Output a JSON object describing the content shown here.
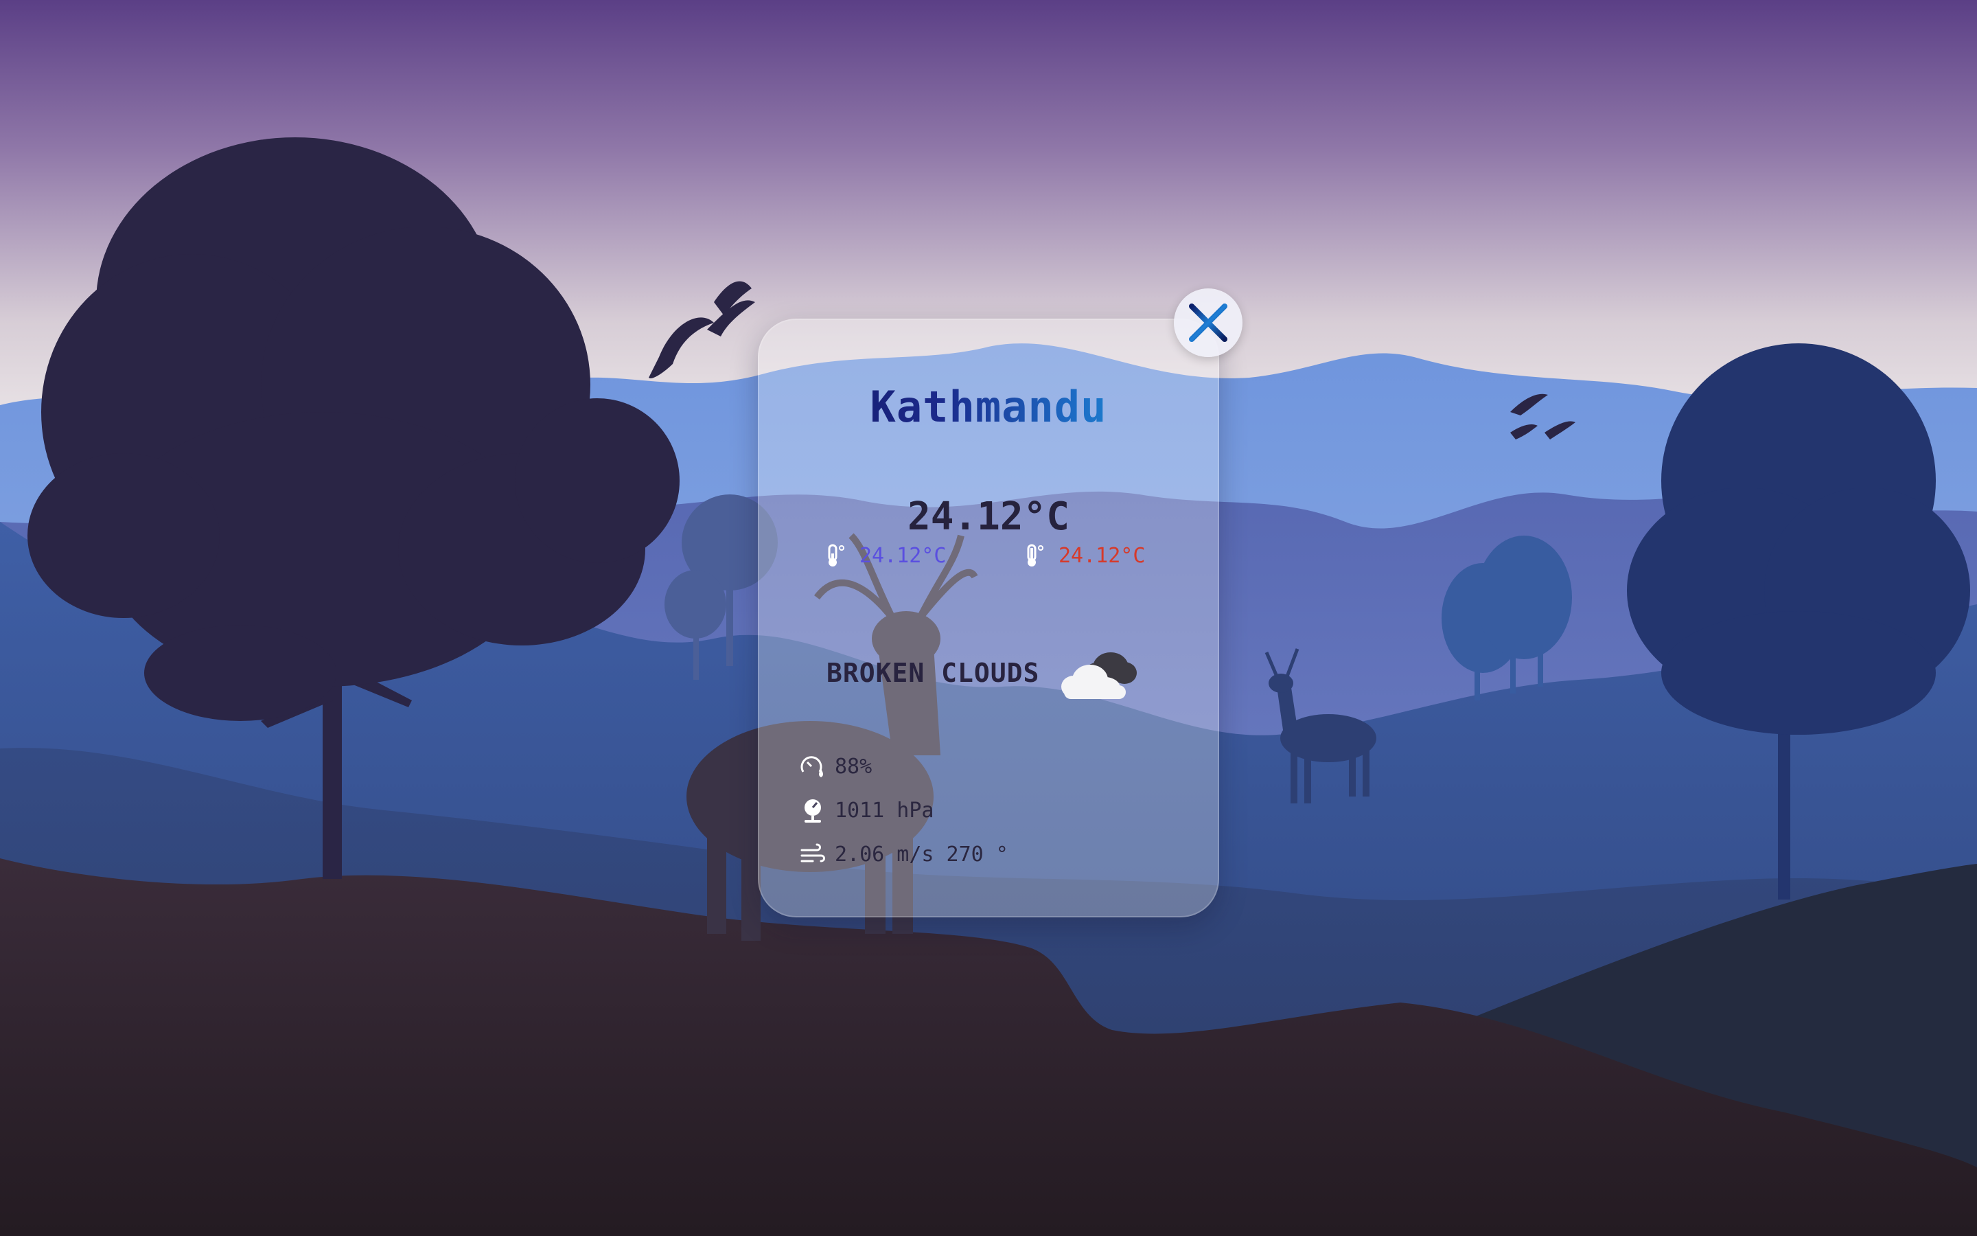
{
  "weather": {
    "city": "Kathmandu",
    "temperature": "24.12°C",
    "temp_min": "24.12°C",
    "temp_max": "24.12°C",
    "condition": "BROKEN CLOUDS",
    "condition_icon": "broken-clouds-icon",
    "humidity": "88%",
    "pressure": "1011 hPa",
    "wind": "2.06 m/s 270 °"
  },
  "icons": {
    "close": "close-icon",
    "temp_min": "thermometer-low-icon",
    "temp_max": "thermometer-high-icon",
    "humidity": "humidity-gauge-icon",
    "pressure": "barometer-icon",
    "wind": "wind-icon"
  },
  "colors": {
    "temp_min": "#5a4fe0",
    "temp_max": "#d63a2a",
    "city_gradient_start": "#14135e",
    "city_gradient_end": "#1aa3dd"
  }
}
